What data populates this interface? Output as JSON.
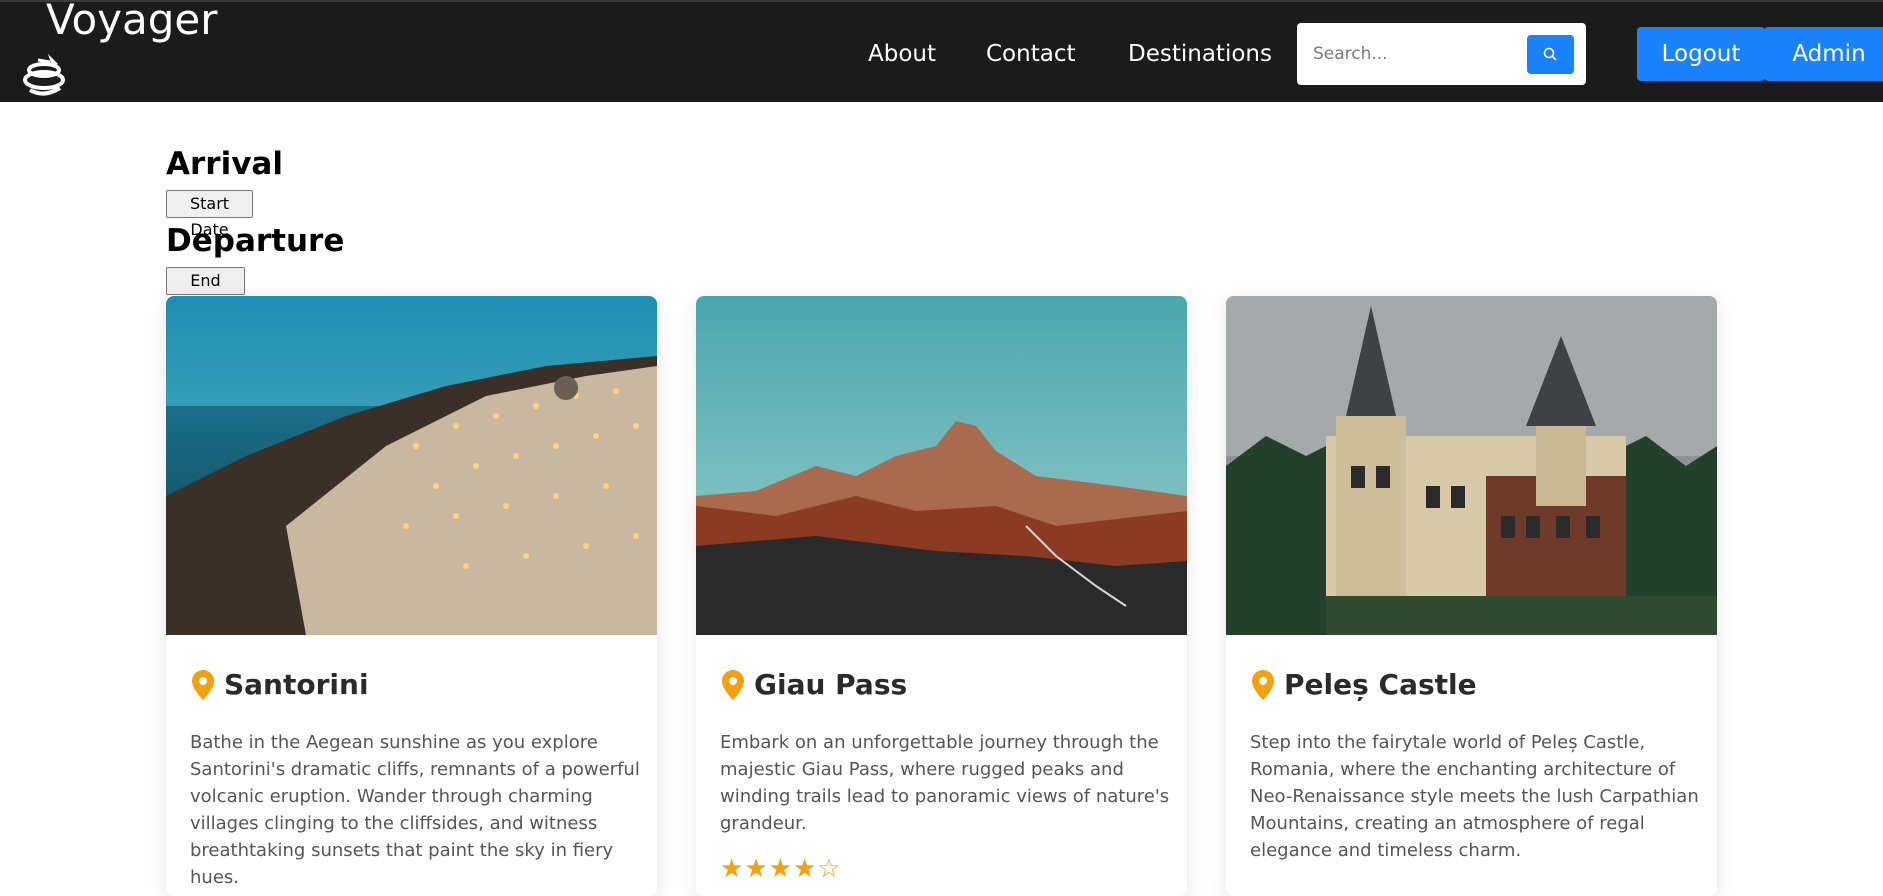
{
  "brand": {
    "name": "Voyager",
    "logo_icon": "globe-plane-icon"
  },
  "nav": {
    "about": "About",
    "contact": "Contact",
    "destinations": "Destinations"
  },
  "search": {
    "placeholder": "Search...",
    "icon": "search-icon"
  },
  "actions": {
    "logout": "Logout",
    "admin": "Admin"
  },
  "colors": {
    "navbar": "#1c1b1b",
    "accent": "#1a82fb",
    "pin": "#f5a00f"
  },
  "dates": {
    "arrival_heading": "Arrival",
    "start_date": "Start Date",
    "departure_heading": "Departure",
    "end_date": "End Date"
  },
  "destinations": [
    {
      "title": "Santorini",
      "description": "Bathe in the Aegean sunshine as you explore Santorini's dramatic cliffs, remnants of a powerful volcanic eruption. Wander through charming villages clinging to the cliffsides, and witness breathtaking sunsets that paint the sky in fiery hues."
    },
    {
      "title": "Giau Pass",
      "description": "Embark on an unforgettable journey through the majestic Giau Pass, where rugged peaks and winding trails lead to panoramic views of nature's grandeur.",
      "rating": 4,
      "rating_max": 5
    },
    {
      "title": "Peleș Castle",
      "description": "Step into the fairytale world of Peleș Castle, Romania, where the enchanting architecture of Neo-Renaissance style meets the lush Carpathian Mountains, creating an atmosphere of regal elegance and timeless charm."
    }
  ]
}
